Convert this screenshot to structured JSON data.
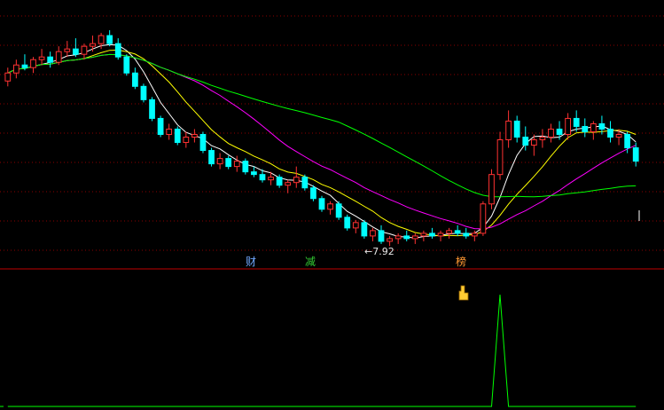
{
  "markers": {
    "cai": "财",
    "jian": "减",
    "bang": "榜"
  },
  "annotations": {
    "low_label": "←7.92"
  },
  "colors": {
    "background": "#000000",
    "up_candle": "#ff3232",
    "down_candle": "#00ffff",
    "ma_fast": "#ffffff",
    "ma_mid": "#ffff00",
    "ma_slow": "#ff00ff",
    "ma_long": "#00ff00",
    "grid": "#8b0000",
    "divider": "#c00000",
    "signal": "#00ff00"
  },
  "chart_data": {
    "type": "candlestick",
    "price_panel": {
      "low_marker_value": 7.92,
      "candles_ohlc": [
        [
          14.1,
          14.6,
          13.9,
          14.4
        ],
        [
          14.4,
          14.9,
          14.2,
          14.7
        ],
        [
          14.7,
          15.1,
          14.5,
          14.6
        ],
        [
          14.6,
          15.0,
          14.4,
          14.9
        ],
        [
          14.9,
          15.3,
          14.7,
          15.0
        ],
        [
          15.0,
          15.2,
          14.6,
          14.8
        ],
        [
          14.8,
          15.4,
          14.7,
          15.2
        ],
        [
          15.2,
          15.6,
          15.0,
          15.3
        ],
        [
          15.3,
          15.7,
          15.0,
          15.1
        ],
        [
          15.1,
          15.5,
          14.9,
          15.4
        ],
        [
          15.4,
          15.8,
          15.2,
          15.5
        ],
        [
          15.5,
          15.9,
          15.3,
          15.8
        ],
        [
          15.8,
          16.0,
          15.4,
          15.5
        ],
        [
          15.5,
          15.7,
          14.9,
          15.0
        ],
        [
          15.0,
          15.1,
          14.3,
          14.4
        ],
        [
          14.4,
          14.6,
          13.8,
          13.9
        ],
        [
          13.9,
          14.0,
          13.3,
          13.4
        ],
        [
          13.4,
          13.5,
          12.6,
          12.7
        ],
        [
          12.7,
          12.8,
          12.0,
          12.1
        ],
        [
          12.1,
          12.5,
          11.9,
          12.3
        ],
        [
          12.3,
          12.4,
          11.7,
          11.8
        ],
        [
          11.8,
          12.2,
          11.6,
          12.0
        ],
        [
          12.0,
          12.3,
          11.8,
          12.1
        ],
        [
          12.1,
          12.2,
          11.4,
          11.5
        ],
        [
          11.5,
          11.6,
          10.9,
          11.0
        ],
        [
          11.0,
          11.4,
          10.8,
          11.2
        ],
        [
          11.2,
          11.3,
          10.8,
          10.9
        ],
        [
          10.9,
          11.3,
          10.7,
          11.1
        ],
        [
          11.1,
          11.2,
          10.6,
          10.7
        ],
        [
          10.7,
          10.9,
          10.5,
          10.6
        ],
        [
          10.6,
          10.8,
          10.3,
          10.4
        ],
        [
          10.4,
          10.7,
          10.2,
          10.5
        ],
        [
          10.5,
          10.6,
          10.1,
          10.2
        ],
        [
          10.2,
          10.4,
          9.9,
          10.3
        ],
        [
          10.3,
          10.9,
          10.1,
          10.5
        ],
        [
          10.5,
          10.6,
          10.0,
          10.1
        ],
        [
          10.1,
          10.2,
          9.6,
          9.7
        ],
        [
          9.7,
          9.8,
          9.2,
          9.3
        ],
        [
          9.3,
          9.6,
          9.1,
          9.5
        ],
        [
          9.5,
          9.6,
          8.9,
          9.0
        ],
        [
          9.0,
          9.1,
          8.5,
          8.6
        ],
        [
          8.6,
          8.9,
          8.4,
          8.8
        ],
        [
          8.8,
          8.9,
          8.2,
          8.3
        ],
        [
          8.3,
          8.6,
          8.1,
          8.5
        ],
        [
          8.5,
          8.7,
          8.0,
          8.1
        ],
        [
          8.1,
          8.3,
          7.92,
          8.2
        ],
        [
          8.2,
          8.4,
          8.0,
          8.3
        ],
        [
          8.3,
          8.5,
          8.1,
          8.2
        ],
        [
          8.2,
          8.4,
          8.0,
          8.3
        ],
        [
          8.3,
          8.5,
          8.1,
          8.4
        ],
        [
          8.4,
          8.6,
          8.2,
          8.3
        ],
        [
          8.3,
          8.5,
          8.1,
          8.4
        ],
        [
          8.4,
          8.6,
          8.2,
          8.5
        ],
        [
          8.5,
          8.7,
          8.3,
          8.4
        ],
        [
          8.4,
          8.6,
          8.2,
          8.3
        ],
        [
          8.3,
          8.5,
          8.1,
          8.4
        ],
        [
          8.4,
          9.6,
          8.3,
          9.5
        ],
        [
          9.5,
          10.8,
          9.3,
          10.6
        ],
        [
          10.6,
          12.2,
          10.4,
          11.9
        ],
        [
          11.9,
          13.0,
          11.6,
          12.6
        ],
        [
          12.6,
          12.8,
          11.8,
          12.0
        ],
        [
          12.0,
          12.4,
          11.5,
          11.7
        ],
        [
          11.7,
          12.1,
          11.3,
          11.9
        ],
        [
          11.9,
          12.3,
          11.6,
          12.0
        ],
        [
          12.0,
          12.5,
          11.8,
          12.3
        ],
        [
          12.3,
          12.6,
          11.9,
          12.1
        ],
        [
          12.1,
          12.9,
          11.9,
          12.7
        ],
        [
          12.7,
          13.0,
          12.2,
          12.4
        ],
        [
          12.4,
          12.7,
          12.0,
          12.2
        ],
        [
          12.2,
          12.6,
          11.9,
          12.5
        ],
        [
          12.5,
          12.8,
          12.1,
          12.3
        ],
        [
          12.3,
          12.6,
          11.8,
          12.0
        ],
        [
          12.0,
          12.3,
          11.7,
          12.1
        ],
        [
          12.1,
          12.2,
          11.4,
          11.6
        ],
        [
          11.6,
          11.8,
          10.9,
          11.1
        ]
      ]
    },
    "indicator_panel": {
      "series": [
        {
          "values": [
            0,
            0,
            0,
            0,
            0,
            0,
            0,
            0,
            0,
            0,
            0,
            0,
            0,
            0,
            0,
            0,
            0,
            0,
            0,
            0,
            0,
            0,
            0,
            0,
            0,
            0,
            0,
            0,
            0,
            0,
            0,
            0,
            0,
            0,
            0,
            0,
            0,
            0,
            0,
            0,
            0,
            0,
            0,
            0,
            0,
            0,
            0,
            0,
            0,
            0,
            0,
            0,
            0,
            0,
            0,
            0,
            0,
            0,
            1,
            0,
            0,
            0,
            0,
            0,
            0,
            0,
            0,
            0,
            0,
            0,
            0,
            0,
            0,
            0,
            0
          ]
        }
      ]
    }
  }
}
